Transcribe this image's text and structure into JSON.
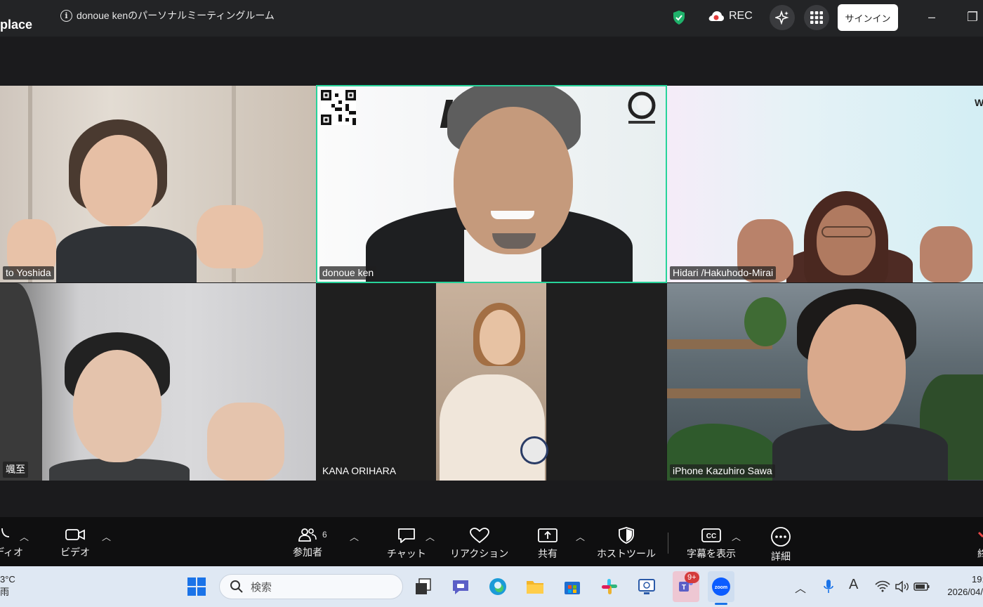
{
  "titlebar": {
    "app_name": "place",
    "meeting_title": "donoue kenのパーソナルミーティングルーム",
    "rec_label": "REC",
    "signin_label": "サインイン",
    "minimize": "–",
    "restore": "❐"
  },
  "participants": [
    {
      "name": "to Yoshida"
    },
    {
      "name": "donoue ken",
      "active": true
    },
    {
      "name": "Hidari /Hakuhodo-Mirai"
    },
    {
      "name": "颯至"
    },
    {
      "name": "KANA ORIHARA"
    },
    {
      "name": "iPhone Kazuhiro Sawa"
    }
  ],
  "toolbar": {
    "audio_label": "ディオ",
    "video_label": "ビデオ",
    "participants_label": "参加者",
    "participants_count": "6",
    "chat_label": "チャット",
    "reactions_label": "リアクション",
    "share_label": "共有",
    "host_tools_label": "ホストツール",
    "captions_label": "字幕を表示",
    "more_label": "詳細",
    "end_label": "終"
  },
  "taskbar": {
    "weather_temp": "3°C",
    "weather_cond": "雨",
    "search_placeholder": "検索",
    "teams_badge": "9+",
    "clock_time": "19:",
    "clock_date": "2026/04/",
    "ime_label": "A"
  },
  "colors": {
    "active_speaker": "#27d39a",
    "shield": "#1fb26b",
    "rec_dot": "#e33b3b",
    "zoom_blue": "#0b5cff"
  }
}
